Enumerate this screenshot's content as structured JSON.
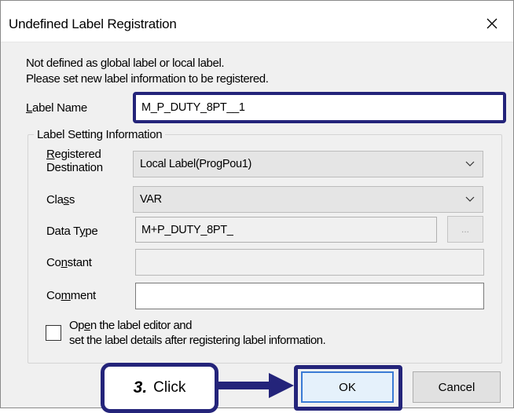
{
  "window": {
    "title": "Undefined Label Registration"
  },
  "message": {
    "line1": "Not defined as global label or local label.",
    "line2": "Please set new label information to be registered."
  },
  "label_name": {
    "label_pre": "",
    "label_u": "L",
    "label_post": "abel Name",
    "value": "M_P_DUTY_8PT__1"
  },
  "group": {
    "title": "Label Setting Information",
    "registered_destination": {
      "label_l1_u": "R",
      "label_l1_post": "egistered",
      "label_l2": "Destination",
      "value": "Local Label(ProgPou1)"
    },
    "class": {
      "label_pre": "Cla",
      "label_u": "s",
      "label_post": "s",
      "value": "VAR"
    },
    "data_type": {
      "label_pre": "Data T",
      "label_u": "y",
      "label_post": "pe",
      "value": "M+P_DUTY_8PT_",
      "browse_label": "..."
    },
    "constant": {
      "label_pre": "Co",
      "label_u": "n",
      "label_post": "stant",
      "value": ""
    },
    "comment": {
      "label_pre": "Co",
      "label_u": "m",
      "label_post": "ment",
      "value": ""
    },
    "open_editor": {
      "line1_pre": "Op",
      "line1_u": "e",
      "line1_post": "n the label editor and",
      "line2": "set the label details after registering label information.",
      "checked": false
    }
  },
  "buttons": {
    "ok": "OK",
    "cancel": "Cancel"
  },
  "annotation": {
    "step": "3.",
    "text": "Click"
  },
  "colors": {
    "highlight": "#24247a",
    "focus": "#3a7bd5"
  },
  "icons": {
    "close": "close-icon",
    "dropdown": "chevron-down-icon",
    "arrow": "right-arrow-icon"
  }
}
